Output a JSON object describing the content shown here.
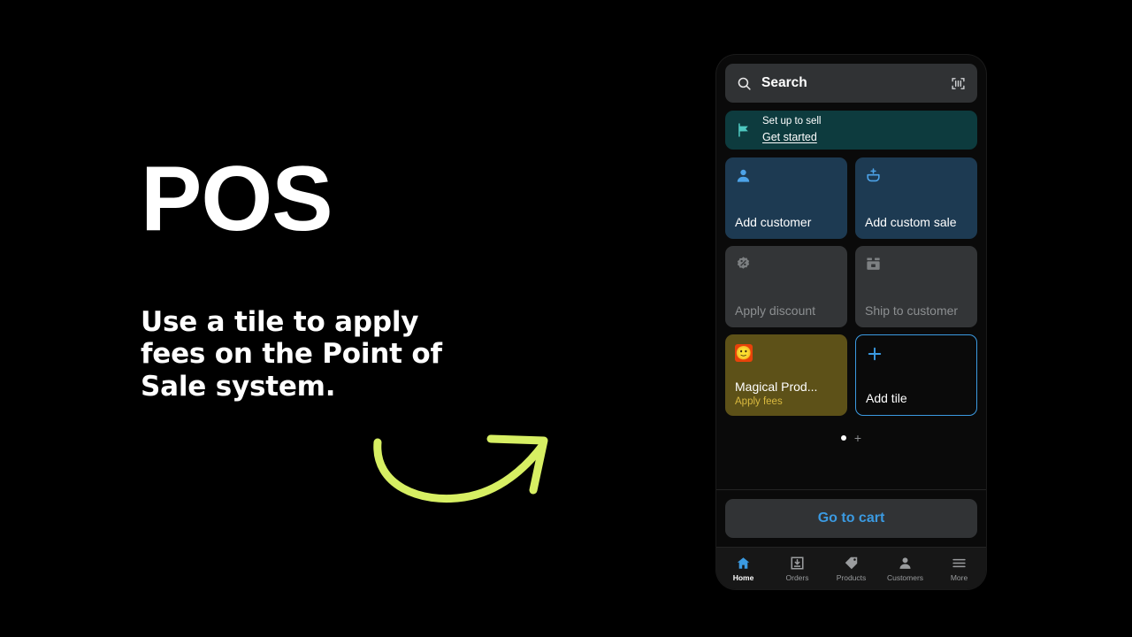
{
  "promo": {
    "title": "POS",
    "subtitle": "Use a tile to apply fees on the Point of Sale system.",
    "arrow_color": "#d7ef63"
  },
  "phone": {
    "search": {
      "placeholder": "Search",
      "value": "Search",
      "search_icon": "search-icon",
      "scan_icon": "barcode-scan-icon"
    },
    "setup_banner": {
      "icon": "flag-icon",
      "title": "Set up to sell",
      "link": "Get started",
      "bg_color": "#0d3b3e",
      "icon_color": "#4ec8c0"
    },
    "tiles": [
      {
        "name": "add-customer",
        "label": "Add customer",
        "sub": "",
        "icon": "person-icon",
        "style": "blue",
        "icon_color": "#4da3e8"
      },
      {
        "name": "add-custom-sale",
        "label": "Add custom sale",
        "sub": "",
        "icon": "basket-plus-icon",
        "style": "blue",
        "icon_color": "#4da3e8"
      },
      {
        "name": "apply-discount",
        "label": "Apply discount",
        "sub": "",
        "icon": "discount-percent-icon",
        "style": "gray",
        "icon_color": "#7d8082"
      },
      {
        "name": "ship-to-customer",
        "label": "Ship to customer",
        "sub": "",
        "icon": "shipping-box-icon",
        "style": "gray",
        "icon_color": "#7d8082"
      },
      {
        "name": "magical-product",
        "label": "Magical Prod...",
        "sub": "Apply fees",
        "icon": "smiley-emoji-icon",
        "emoji": "🙂",
        "style": "olive",
        "icon_color": "#f5a623"
      },
      {
        "name": "add-tile",
        "label": "Add tile",
        "sub": "",
        "icon": "plus-icon",
        "style": "add",
        "icon_color": "#3b9ae1"
      }
    ],
    "pager": {
      "dots": 1,
      "active_index": 0,
      "add_page_label": "+"
    },
    "cart": {
      "label": "Go to cart",
      "color": "#3b9ae1"
    },
    "nav": [
      {
        "label": "Home",
        "icon": "home-icon",
        "active": true
      },
      {
        "label": "Orders",
        "icon": "orders-inbox-icon",
        "active": false
      },
      {
        "label": "Products",
        "icon": "tag-icon",
        "active": false
      },
      {
        "label": "Customers",
        "icon": "person-icon",
        "active": false
      },
      {
        "label": "More",
        "icon": "hamburger-menu-icon",
        "active": false
      }
    ]
  }
}
